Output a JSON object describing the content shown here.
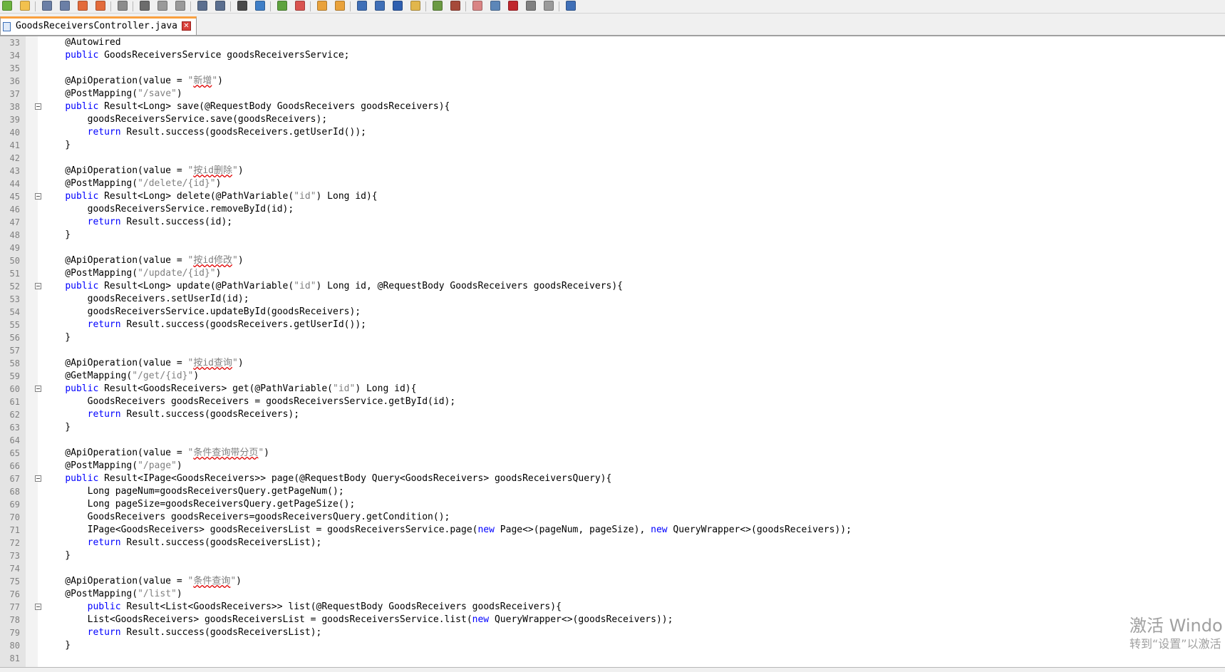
{
  "toolbar": {
    "buttons": [
      {
        "icon": "new-file-icon",
        "color": "#6cb33f"
      },
      {
        "icon": "open-file-icon",
        "color": "#f2c14e"
      },
      {
        "icon": "save-icon",
        "color": "#6b7fa6"
      },
      {
        "icon": "save-all-icon",
        "color": "#6b7fa6"
      },
      {
        "icon": "close-icon",
        "color": "#e36b3b"
      },
      {
        "icon": "close-all-icon",
        "color": "#e36b3b"
      },
      {
        "icon": "print-icon",
        "color": "#8c8c8c"
      },
      {
        "icon": "cut-icon",
        "color": "#6d6d6d"
      },
      {
        "icon": "copy-icon",
        "color": "#9a9a9a"
      },
      {
        "icon": "paste-icon",
        "color": "#9a9a9a"
      },
      {
        "icon": "undo-icon",
        "color": "#5b6f8f"
      },
      {
        "icon": "redo-icon",
        "color": "#5b6f8f"
      },
      {
        "icon": "find-icon",
        "color": "#4a4a4a"
      },
      {
        "icon": "replace-icon",
        "color": "#3f7fc7"
      },
      {
        "icon": "zoom-in-icon",
        "color": "#5ea23e"
      },
      {
        "icon": "zoom-out-icon",
        "color": "#d9534f"
      },
      {
        "icon": "sync-vertical-icon",
        "color": "#e9a23b"
      },
      {
        "icon": "sync-horizontal-icon",
        "color": "#e9a23b"
      },
      {
        "icon": "word-wrap-icon",
        "color": "#3f6fb7"
      },
      {
        "icon": "show-all-characters-icon",
        "color": "#3f6fb7"
      },
      {
        "icon": "indent-guide-icon",
        "color": "#2f5faf"
      },
      {
        "icon": "user-language-icon",
        "color": "#e1b64c"
      },
      {
        "icon": "document-map-icon",
        "color": "#6b9a43"
      },
      {
        "icon": "function-list-icon",
        "color": "#a64a3a"
      },
      {
        "icon": "folder-workspace-icon",
        "color": "#d98484"
      },
      {
        "icon": "monitoring-icon",
        "color": "#5c86b8"
      },
      {
        "icon": "record-macro-icon",
        "color": "#c0262c"
      },
      {
        "icon": "stop-macro-icon",
        "color": "#808080"
      },
      {
        "icon": "play-macro-icon",
        "color": "#9a9a9a"
      },
      {
        "icon": "run-macro-multiple-icon",
        "color": "#3f6fb7"
      },
      {
        "icon": "save-macro-icon",
        "color": "#808080"
      },
      {
        "icon": "spell-check-icon",
        "color": "#c0262c"
      }
    ]
  },
  "tab": {
    "title": "GoodsReceiversController.java",
    "icon": "saved-file-icon",
    "close_icon": "close-tab-icon"
  },
  "colors": {
    "keyword": "#0000ff",
    "string": "#808080",
    "plain": "#000000",
    "line_number": "#808080",
    "squiggle": "#e00000",
    "active_tab_accent": "#f9a03f"
  },
  "editor": {
    "lines": [
      {
        "num": "33",
        "fold": false,
        "parts": [
          {
            "t": "    @Autowired",
            "c": "p"
          }
        ]
      },
      {
        "num": "34",
        "fold": false,
        "parts": [
          {
            "t": "    ",
            "c": "p"
          },
          {
            "t": "public",
            "c": "k"
          },
          {
            "t": " GoodsReceiversService goodsReceiversService;",
            "c": "p"
          }
        ]
      },
      {
        "num": "35",
        "fold": false,
        "parts": []
      },
      {
        "num": "36",
        "fold": false,
        "parts": [
          {
            "t": "    @ApiOperation(value = ",
            "c": "p"
          },
          {
            "t": "\"",
            "c": "s"
          },
          {
            "t": "新增",
            "c": "sw"
          },
          {
            "t": "\"",
            "c": "s"
          },
          {
            "t": ")",
            "c": "p"
          }
        ]
      },
      {
        "num": "37",
        "fold": false,
        "parts": [
          {
            "t": "    @PostMapping(",
            "c": "p"
          },
          {
            "t": "\"/save\"",
            "c": "s"
          },
          {
            "t": ")",
            "c": "p"
          }
        ]
      },
      {
        "num": "38",
        "fold": true,
        "parts": [
          {
            "t": "    ",
            "c": "p"
          },
          {
            "t": "public",
            "c": "k"
          },
          {
            "t": " Result<Long> save(@RequestBody GoodsReceivers goodsReceivers){",
            "c": "p"
          }
        ]
      },
      {
        "num": "39",
        "fold": false,
        "parts": [
          {
            "t": "        goodsReceiversService.save(goodsReceivers);",
            "c": "p"
          }
        ]
      },
      {
        "num": "40",
        "fold": false,
        "parts": [
          {
            "t": "        ",
            "c": "p"
          },
          {
            "t": "return",
            "c": "k"
          },
          {
            "t": " Result.success(goodsReceivers.getUserId());",
            "c": "p"
          }
        ]
      },
      {
        "num": "41",
        "fold": false,
        "parts": [
          {
            "t": "    }",
            "c": "p"
          }
        ]
      },
      {
        "num": "42",
        "fold": false,
        "parts": []
      },
      {
        "num": "43",
        "fold": false,
        "parts": [
          {
            "t": "    @ApiOperation(value = ",
            "c": "p"
          },
          {
            "t": "\"",
            "c": "s"
          },
          {
            "t": "按id删除",
            "c": "sw"
          },
          {
            "t": "\"",
            "c": "s"
          },
          {
            "t": ")",
            "c": "p"
          }
        ]
      },
      {
        "num": "44",
        "fold": false,
        "parts": [
          {
            "t": "    @PostMapping(",
            "c": "p"
          },
          {
            "t": "\"/delete/{id}\"",
            "c": "s"
          },
          {
            "t": ")",
            "c": "p"
          }
        ]
      },
      {
        "num": "45",
        "fold": true,
        "parts": [
          {
            "t": "    ",
            "c": "p"
          },
          {
            "t": "public",
            "c": "k"
          },
          {
            "t": " Result<Long> delete(@PathVariable(",
            "c": "p"
          },
          {
            "t": "\"id\"",
            "c": "s"
          },
          {
            "t": ") Long id){",
            "c": "p"
          }
        ]
      },
      {
        "num": "46",
        "fold": false,
        "parts": [
          {
            "t": "        goodsReceiversService.removeById(id);",
            "c": "p"
          }
        ]
      },
      {
        "num": "47",
        "fold": false,
        "parts": [
          {
            "t": "        ",
            "c": "p"
          },
          {
            "t": "return",
            "c": "k"
          },
          {
            "t": " Result.success(id);",
            "c": "p"
          }
        ]
      },
      {
        "num": "48",
        "fold": false,
        "parts": [
          {
            "t": "    }",
            "c": "p"
          }
        ]
      },
      {
        "num": "49",
        "fold": false,
        "parts": []
      },
      {
        "num": "50",
        "fold": false,
        "parts": [
          {
            "t": "    @ApiOperation(value = ",
            "c": "p"
          },
          {
            "t": "\"",
            "c": "s"
          },
          {
            "t": "按id修改",
            "c": "sw"
          },
          {
            "t": "\"",
            "c": "s"
          },
          {
            "t": ")",
            "c": "p"
          }
        ]
      },
      {
        "num": "51",
        "fold": false,
        "parts": [
          {
            "t": "    @PostMapping(",
            "c": "p"
          },
          {
            "t": "\"/update/{id}\"",
            "c": "s"
          },
          {
            "t": ")",
            "c": "p"
          }
        ]
      },
      {
        "num": "52",
        "fold": true,
        "parts": [
          {
            "t": "    ",
            "c": "p"
          },
          {
            "t": "public",
            "c": "k"
          },
          {
            "t": " Result<Long> update(@PathVariable(",
            "c": "p"
          },
          {
            "t": "\"id\"",
            "c": "s"
          },
          {
            "t": ") Long id, @RequestBody GoodsReceivers goodsReceivers){",
            "c": "p"
          }
        ]
      },
      {
        "num": "53",
        "fold": false,
        "parts": [
          {
            "t": "        goodsReceivers.setUserId(id);",
            "c": "p"
          }
        ]
      },
      {
        "num": "54",
        "fold": false,
        "parts": [
          {
            "t": "        goodsReceiversService.updateById(goodsReceivers);",
            "c": "p"
          }
        ]
      },
      {
        "num": "55",
        "fold": false,
        "parts": [
          {
            "t": "        ",
            "c": "p"
          },
          {
            "t": "return",
            "c": "k"
          },
          {
            "t": " Result.success(goodsReceivers.getUserId());",
            "c": "p"
          }
        ]
      },
      {
        "num": "56",
        "fold": false,
        "parts": [
          {
            "t": "    }",
            "c": "p"
          }
        ]
      },
      {
        "num": "57",
        "fold": false,
        "parts": []
      },
      {
        "num": "58",
        "fold": false,
        "parts": [
          {
            "t": "    @ApiOperation(value = ",
            "c": "p"
          },
          {
            "t": "\"",
            "c": "s"
          },
          {
            "t": "按id查询",
            "c": "sw"
          },
          {
            "t": "\"",
            "c": "s"
          },
          {
            "t": ")",
            "c": "p"
          }
        ]
      },
      {
        "num": "59",
        "fold": false,
        "parts": [
          {
            "t": "    @GetMapping(",
            "c": "p"
          },
          {
            "t": "\"/get/{id}\"",
            "c": "s"
          },
          {
            "t": ")",
            "c": "p"
          }
        ]
      },
      {
        "num": "60",
        "fold": true,
        "parts": [
          {
            "t": "    ",
            "c": "p"
          },
          {
            "t": "public",
            "c": "k"
          },
          {
            "t": " Result<GoodsReceivers> get(@PathVariable(",
            "c": "p"
          },
          {
            "t": "\"id\"",
            "c": "s"
          },
          {
            "t": ") Long id){",
            "c": "p"
          }
        ]
      },
      {
        "num": "61",
        "fold": false,
        "parts": [
          {
            "t": "        GoodsReceivers goodsReceivers = goodsReceiversService.getById(id);",
            "c": "p"
          }
        ]
      },
      {
        "num": "62",
        "fold": false,
        "parts": [
          {
            "t": "        ",
            "c": "p"
          },
          {
            "t": "return",
            "c": "k"
          },
          {
            "t": " Result.success(goodsReceivers);",
            "c": "p"
          }
        ]
      },
      {
        "num": "63",
        "fold": false,
        "parts": [
          {
            "t": "    }",
            "c": "p"
          }
        ]
      },
      {
        "num": "64",
        "fold": false,
        "parts": []
      },
      {
        "num": "65",
        "fold": false,
        "parts": [
          {
            "t": "    @ApiOperation(value = ",
            "c": "p"
          },
          {
            "t": "\"",
            "c": "s"
          },
          {
            "t": "条件查询带分页",
            "c": "sw"
          },
          {
            "t": "\"",
            "c": "s"
          },
          {
            "t": ")",
            "c": "p"
          }
        ]
      },
      {
        "num": "66",
        "fold": false,
        "parts": [
          {
            "t": "    @PostMapping(",
            "c": "p"
          },
          {
            "t": "\"/page\"",
            "c": "s"
          },
          {
            "t": ")",
            "c": "p"
          }
        ]
      },
      {
        "num": "67",
        "fold": true,
        "parts": [
          {
            "t": "    ",
            "c": "p"
          },
          {
            "t": "public",
            "c": "k"
          },
          {
            "t": " Result<IPage<GoodsReceivers>> page(@RequestBody Query<GoodsReceivers> goodsReceiversQuery){",
            "c": "p"
          }
        ]
      },
      {
        "num": "68",
        "fold": false,
        "parts": [
          {
            "t": "        Long pageNum=goodsReceiversQuery.getPageNum();",
            "c": "p"
          }
        ]
      },
      {
        "num": "69",
        "fold": false,
        "parts": [
          {
            "t": "        Long pageSize=goodsReceiversQuery.getPageSize();",
            "c": "p"
          }
        ]
      },
      {
        "num": "70",
        "fold": false,
        "parts": [
          {
            "t": "        GoodsReceivers goodsReceivers=goodsReceiversQuery.getCondition();",
            "c": "p"
          }
        ]
      },
      {
        "num": "71",
        "fold": false,
        "parts": [
          {
            "t": "        IPage<GoodsReceivers> goodsReceiversList = goodsReceiversService.page(",
            "c": "p"
          },
          {
            "t": "new",
            "c": "k"
          },
          {
            "t": " Page<>(pageNum, pageSize), ",
            "c": "p"
          },
          {
            "t": "new",
            "c": "k"
          },
          {
            "t": " QueryWrapper<>(goodsReceivers));",
            "c": "p"
          }
        ]
      },
      {
        "num": "72",
        "fold": false,
        "parts": [
          {
            "t": "        ",
            "c": "p"
          },
          {
            "t": "return",
            "c": "k"
          },
          {
            "t": " Result.success(goodsReceiversList);",
            "c": "p"
          }
        ]
      },
      {
        "num": "73",
        "fold": false,
        "parts": [
          {
            "t": "    }",
            "c": "p"
          }
        ]
      },
      {
        "num": "74",
        "fold": false,
        "parts": []
      },
      {
        "num": "75",
        "fold": false,
        "parts": [
          {
            "t": "    @ApiOperation(value = ",
            "c": "p"
          },
          {
            "t": "\"",
            "c": "s"
          },
          {
            "t": "条件查询",
            "c": "sw"
          },
          {
            "t": "\"",
            "c": "s"
          },
          {
            "t": ")",
            "c": "p"
          }
        ]
      },
      {
        "num": "76",
        "fold": false,
        "parts": [
          {
            "t": "    @PostMapping(",
            "c": "p"
          },
          {
            "t": "\"/list\"",
            "c": "s"
          },
          {
            "t": ")",
            "c": "p"
          }
        ]
      },
      {
        "num": "77",
        "fold": true,
        "parts": [
          {
            "t": "        ",
            "c": "p"
          },
          {
            "t": "public",
            "c": "k"
          },
          {
            "t": " Result<List<GoodsReceivers>> list(@RequestBody GoodsReceivers goodsReceivers){",
            "c": "p"
          }
        ]
      },
      {
        "num": "78",
        "fold": false,
        "parts": [
          {
            "t": "        List<GoodsReceivers> goodsReceiversList = goodsReceiversService.list(",
            "c": "p"
          },
          {
            "t": "new",
            "c": "k"
          },
          {
            "t": " QueryWrapper<>(goodsReceivers));",
            "c": "p"
          }
        ]
      },
      {
        "num": "79",
        "fold": false,
        "parts": [
          {
            "t": "        ",
            "c": "p"
          },
          {
            "t": "return",
            "c": "k"
          },
          {
            "t": " Result.success(goodsReceiversList);",
            "c": "p"
          }
        ]
      },
      {
        "num": "80",
        "fold": false,
        "parts": [
          {
            "t": "    }",
            "c": "p"
          }
        ]
      },
      {
        "num": "81",
        "fold": false,
        "parts": []
      }
    ]
  },
  "watermark": {
    "line1": "激活 Windo",
    "line2": "转到“设置”以激活"
  }
}
